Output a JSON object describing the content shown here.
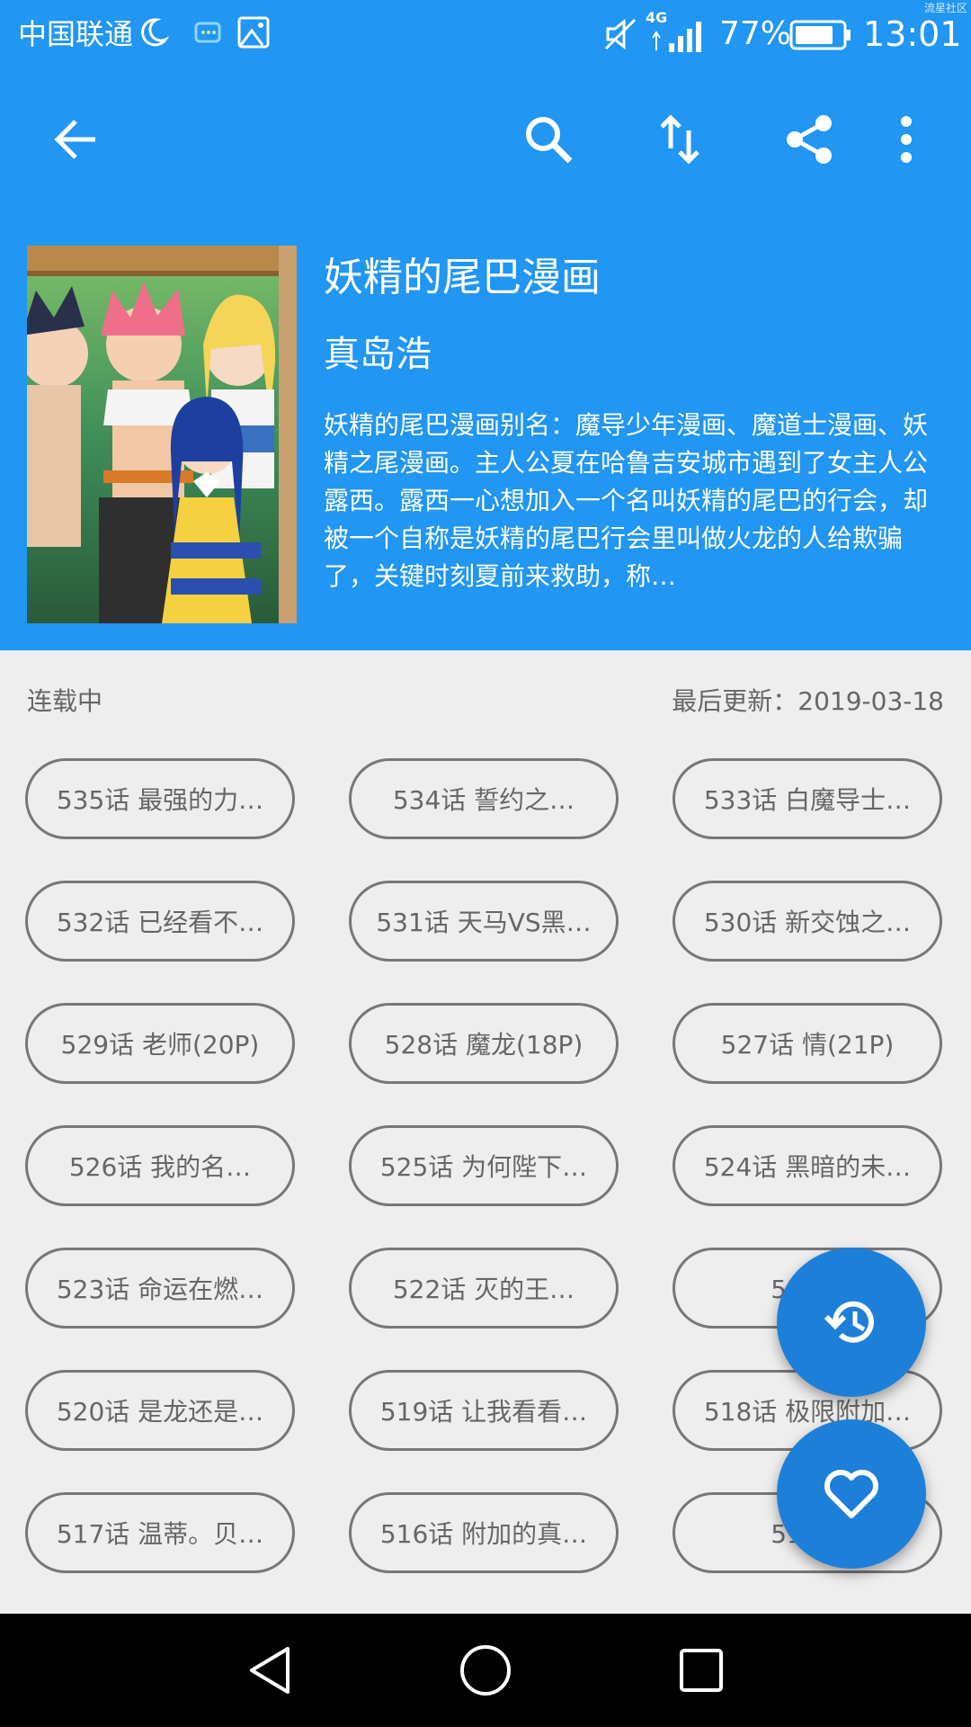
{
  "status_bar": {
    "carrier": "中国联通",
    "network": "4G",
    "battery": "77%",
    "time": "13:01",
    "watermark": "流星社区",
    "icons": [
      "moon-icon",
      "chat-bubble-icon",
      "image-icon",
      "mute-icon",
      "signal-icon",
      "battery-icon"
    ]
  },
  "toolbar": {
    "icons": [
      "back-arrow-icon",
      "search-icon",
      "sort-icon",
      "share-icon",
      "more-vert-icon"
    ]
  },
  "comic": {
    "title": "妖精的尾巴漫画",
    "author": "真岛浩",
    "description": "妖精的尾巴漫画别名：魔导少年漫画、魔道士漫画、妖精之尾漫画。主人公夏在哈鲁吉安城市遇到了女主人公露西。露西一心想加入一个名叫妖精的尾巴的行会，却被一个自称是妖精的尾巴行会里叫做火龙的人给欺骗了，关键时刻夏前来救助，称…",
    "status": "连载中",
    "last_updated": "最后更新：2019-03-18"
  },
  "chapters": [
    "535话 最强的力…",
    "534话 誓约之…",
    "533话 白魔导士…",
    "532话 已经看不…",
    "531话 天马VS黑…",
    "530话 新交蚀之…",
    "529话 老师(20P)",
    "528话 魔龙(18P)",
    "527话 情(21P)",
    "526话 我的名…",
    "525话 为何陛下…",
    "524话 黑暗的未…",
    "523话 命运在燃…",
    "522话 灭的王…",
    "521话",
    "520话 是龙还是…",
    "519话 让我看看…",
    "518话 极限附加…",
    "517话 温蒂。贝…",
    "516话 附加的真…",
    "515话"
  ],
  "fabs": [
    "history-icon",
    "heart-icon"
  ],
  "navigation": [
    "back-triangle-icon",
    "home-circle-icon",
    "recents-square-icon"
  ],
  "colors": {
    "primary": "#2196f3",
    "fab": "#1e7fd8",
    "background": "#eeeeee",
    "chip_border": "#777777",
    "text_gray": "#666666"
  }
}
